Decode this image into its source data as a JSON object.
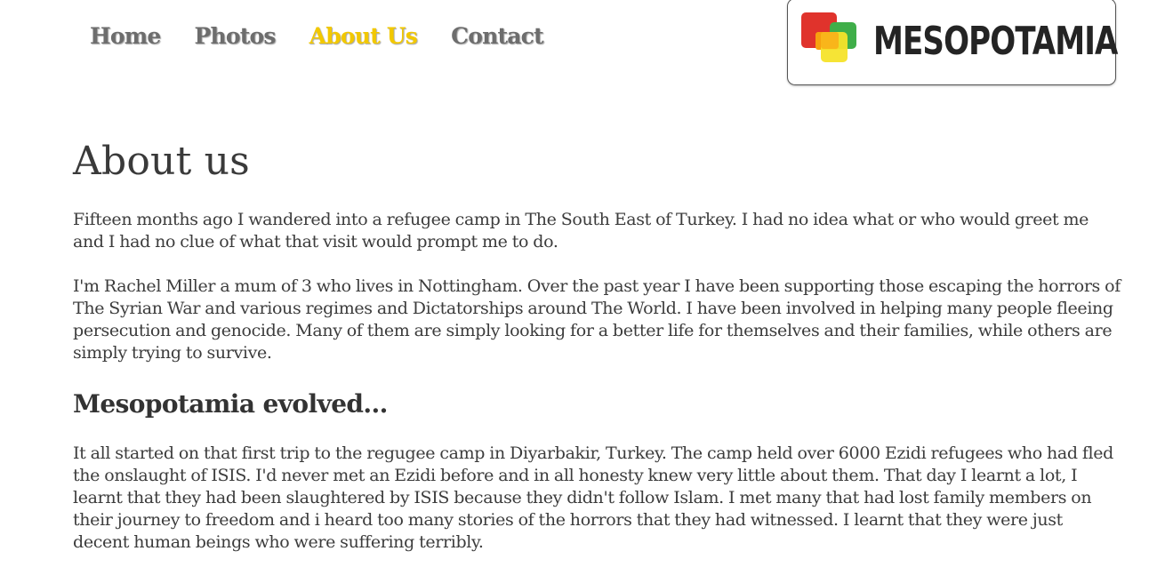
{
  "nav": {
    "items": [
      {
        "label": "Home"
      },
      {
        "label": "Photos"
      },
      {
        "label": "About Us"
      },
      {
        "label": "Contact"
      }
    ],
    "active_color": "#f2c800",
    "inactive_color": "#6d6d6d"
  },
  "logo": {
    "text": "MESOPOTAMIA",
    "icon_colors": [
      "#e0332c",
      "#3fae49",
      "#f7a10f",
      "#f5e32a"
    ]
  },
  "main": {
    "title": "About us",
    "paragraph_1": "Fifteen months ago I wandered into a refugee camp in The South East of Turkey. I had no idea what or who would greet me and I had no clue of what that visit would prompt me to do.",
    "paragraph_2": "I'm Rachel Miller a mum of 3 who lives in Nottingham. Over the past year I have been supporting those escaping  the horrors of The Syrian War and various regimes and Dictatorships around The World. I have been involved in helping many people fleeing persecution and genocide. Many of them are simply looking for a better life for themselves and their families, while others are simply trying to survive.",
    "subheading": "Mesopotamia evolved...",
    "paragraph_3": "It all started on that first trip to the regugee camp in Diyarbakir, Turkey. The camp held over 6000 Ezidi refugees who had fled the onslaught of ISIS. I'd never met an Ezidi before and in all honesty knew very little about them. That day I learnt a lot, I learnt that they had been slaughtered by ISIS because they didn't follow Islam. I met many that had lost family members on their journey to freedom and i heard too many stories of the horrors that they had witnessed. I learnt that they were just decent human beings who were suffering terribly."
  }
}
